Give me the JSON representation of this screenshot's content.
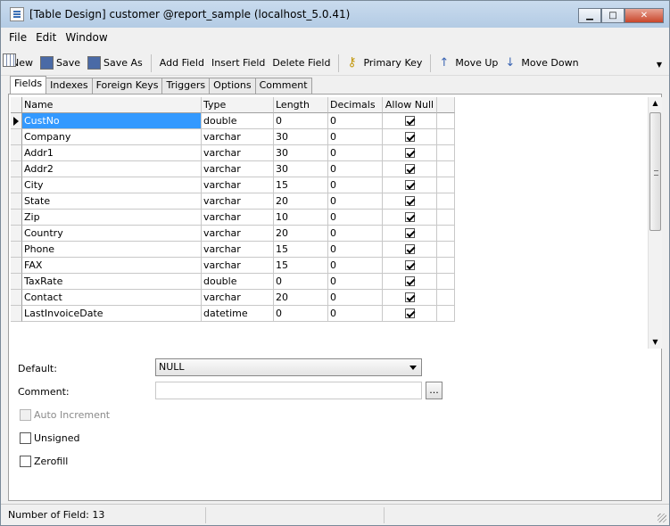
{
  "window": {
    "title": "[Table Design] customer @report_sample (localhost_5.0.41)",
    "controls": {
      "minimize": "▁",
      "maximize": "□",
      "close": "✕"
    }
  },
  "menu": [
    "File",
    "Edit",
    "Window"
  ],
  "toolbar": {
    "new": "New",
    "save": "Save",
    "save_as": "Save As",
    "add_field": "Add Field",
    "insert_field": "Insert Field",
    "delete_field": "Delete Field",
    "primary_key": "Primary Key",
    "move_up": "Move Up",
    "move_down": "Move Down"
  },
  "tabs": [
    "Fields",
    "Indexes",
    "Foreign Keys",
    "Triggers",
    "Options",
    "Comment"
  ],
  "active_tab": "Fields",
  "grid": {
    "columns": [
      "Name",
      "Type",
      "Length",
      "Decimals",
      "Allow Null"
    ],
    "rows": [
      {
        "name": "CustNo",
        "type": "double",
        "length": "0",
        "decimals": "0",
        "allow_null": true
      },
      {
        "name": "Company",
        "type": "varchar",
        "length": "30",
        "decimals": "0",
        "allow_null": true
      },
      {
        "name": "Addr1",
        "type": "varchar",
        "length": "30",
        "decimals": "0",
        "allow_null": true
      },
      {
        "name": "Addr2",
        "type": "varchar",
        "length": "30",
        "decimals": "0",
        "allow_null": true
      },
      {
        "name": "City",
        "type": "varchar",
        "length": "15",
        "decimals": "0",
        "allow_null": true
      },
      {
        "name": "State",
        "type": "varchar",
        "length": "20",
        "decimals": "0",
        "allow_null": true
      },
      {
        "name": "Zip",
        "type": "varchar",
        "length": "10",
        "decimals": "0",
        "allow_null": true
      },
      {
        "name": "Country",
        "type": "varchar",
        "length": "20",
        "decimals": "0",
        "allow_null": true
      },
      {
        "name": "Phone",
        "type": "varchar",
        "length": "15",
        "decimals": "0",
        "allow_null": true
      },
      {
        "name": "FAX",
        "type": "varchar",
        "length": "15",
        "decimals": "0",
        "allow_null": true
      },
      {
        "name": "TaxRate",
        "type": "double",
        "length": "0",
        "decimals": "0",
        "allow_null": true
      },
      {
        "name": "Contact",
        "type": "varchar",
        "length": "20",
        "decimals": "0",
        "allow_null": true
      },
      {
        "name": "LastInvoiceDate",
        "type": "datetime",
        "length": "0",
        "decimals": "0",
        "allow_null": true
      }
    ],
    "selected_row": 0
  },
  "properties": {
    "default_label": "Default:",
    "default_value": "NULL",
    "comment_label": "Comment:",
    "comment_value": "",
    "ellipsis": "...",
    "auto_increment": {
      "label": "Auto Increment",
      "checked": false,
      "enabled": false
    },
    "unsigned": {
      "label": "Unsigned",
      "checked": false,
      "enabled": true
    },
    "zerofill": {
      "label": "Zerofill",
      "checked": false,
      "enabled": true
    }
  },
  "status": {
    "text": "Number of Field: 13"
  }
}
